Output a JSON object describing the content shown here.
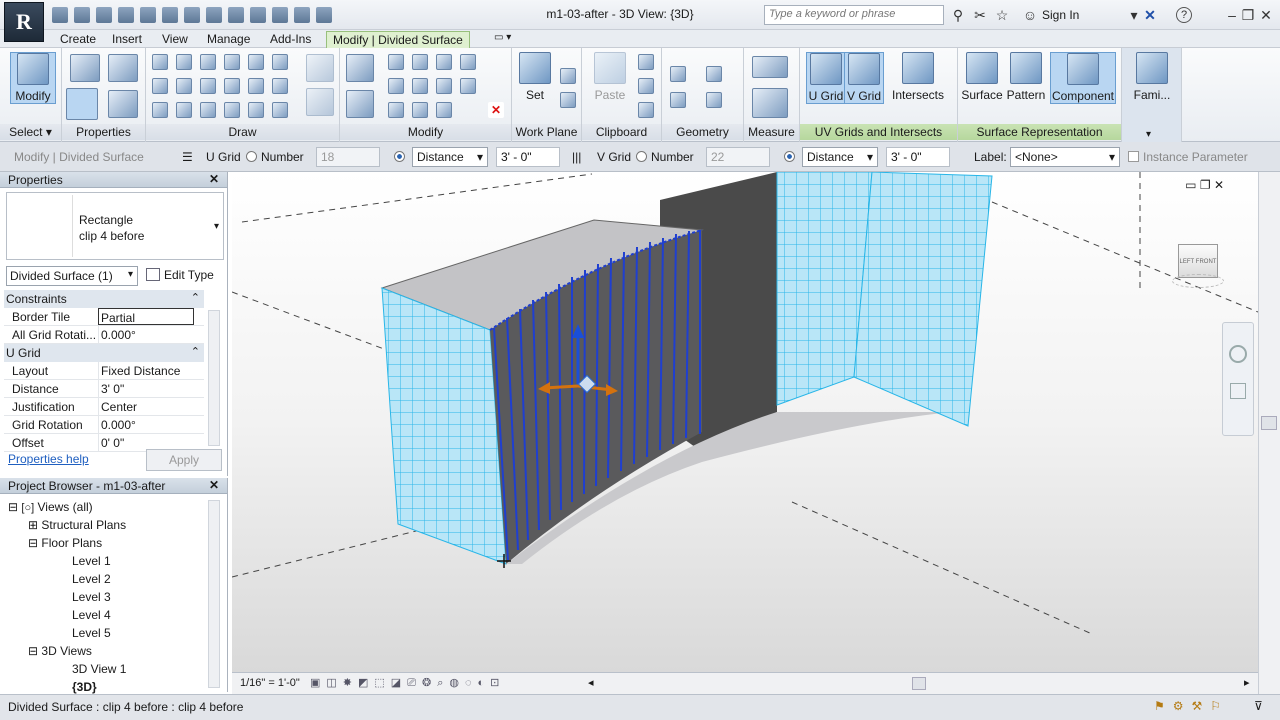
{
  "titlebar": {
    "logo": "R",
    "title": "m1-03-after - 3D View: {3D}",
    "search_placeholder": "Type a keyword or phrase",
    "sign_in": "Sign In",
    "help": "?"
  },
  "tabs": [
    {
      "label": "Create"
    },
    {
      "label": "Insert"
    },
    {
      "label": "View"
    },
    {
      "label": "Manage"
    },
    {
      "label": "Add-Ins"
    },
    {
      "label": "Modify | Divided Surface",
      "active": true
    }
  ],
  "ribbon": {
    "panels": [
      {
        "label": "Select ▾"
      },
      {
        "label": "Properties"
      },
      {
        "label": "Draw"
      },
      {
        "label": "Modify"
      },
      {
        "label": "Work Plane"
      },
      {
        "label": "Clipboard"
      },
      {
        "label": "Geometry"
      },
      {
        "label": "Measure"
      },
      {
        "label": "UV Grids and Intersects"
      },
      {
        "label": "Surface Representation"
      }
    ],
    "buttons": {
      "modify": "Modify",
      "set": "Set",
      "paste": "Paste",
      "u_grid": "U Grid",
      "v_grid": "V Grid",
      "intersects": "Intersects",
      "surface": "Surface",
      "pattern": "Pattern",
      "component": "Component",
      "family": "Fami..."
    }
  },
  "options_bar": {
    "context": "Modify | Divided Surface",
    "u_grid_label": "U Grid",
    "u_number_label": "Number",
    "u_number_value": "18",
    "u_mode": "Distance",
    "u_distance": "3' - 0\"",
    "v_grid_label": "V Grid",
    "v_number_label": "Number",
    "v_number_value": "22",
    "v_mode": "Distance",
    "v_distance": "3' - 0\"",
    "label_label": "Label:",
    "label_value": "<None>",
    "instance_param": "Instance Parameter"
  },
  "properties": {
    "title": "Properties",
    "type_name": "Rectangle",
    "type_sub": "clip 4 before",
    "selector": "Divided Surface (1)",
    "edit_type": "Edit Type",
    "groups": [
      {
        "name": "Constraints",
        "rows": [
          {
            "k": "Border Tile",
            "v": "Partial"
          },
          {
            "k": "All Grid Rotati...",
            "v": "0.000°"
          }
        ]
      },
      {
        "name": "U Grid",
        "rows": [
          {
            "k": "Layout",
            "v": "Fixed Distance"
          },
          {
            "k": "Distance",
            "v": "3'  0\""
          },
          {
            "k": "Justification",
            "v": "Center"
          },
          {
            "k": "Grid Rotation",
            "v": "0.000°"
          },
          {
            "k": "Offset",
            "v": "0'  0\""
          }
        ]
      }
    ],
    "help": "Properties help",
    "apply": "Apply"
  },
  "browser": {
    "title": "Project Browser - m1-03-after",
    "items": [
      {
        "label": "Views (all)",
        "indent": 0,
        "toggle": "⊟"
      },
      {
        "label": "Structural Plans",
        "indent": 1,
        "toggle": "⊞"
      },
      {
        "label": "Floor Plans",
        "indent": 1,
        "toggle": "⊟"
      },
      {
        "label": "Level 1",
        "indent": 2
      },
      {
        "label": "Level 2",
        "indent": 2
      },
      {
        "label": "Level 3",
        "indent": 2
      },
      {
        "label": "Level 4",
        "indent": 2
      },
      {
        "label": "Level 5",
        "indent": 2
      },
      {
        "label": "3D Views",
        "indent": 1,
        "toggle": "⊟"
      },
      {
        "label": "3D View 1",
        "indent": 2
      },
      {
        "label": "{3D}",
        "indent": 2,
        "bold": true
      }
    ]
  },
  "view_bar": {
    "scale": "1/16\" = 1'-0\""
  },
  "viewcube": {
    "left": "LEFT",
    "front": "FRONT"
  },
  "status": {
    "text": "Divided Surface : clip 4 before : clip 4 before"
  },
  "colors": {
    "grid": "#29b6e8",
    "selected": "#1f3fd0",
    "ribbon_active": "#dff0d0"
  }
}
